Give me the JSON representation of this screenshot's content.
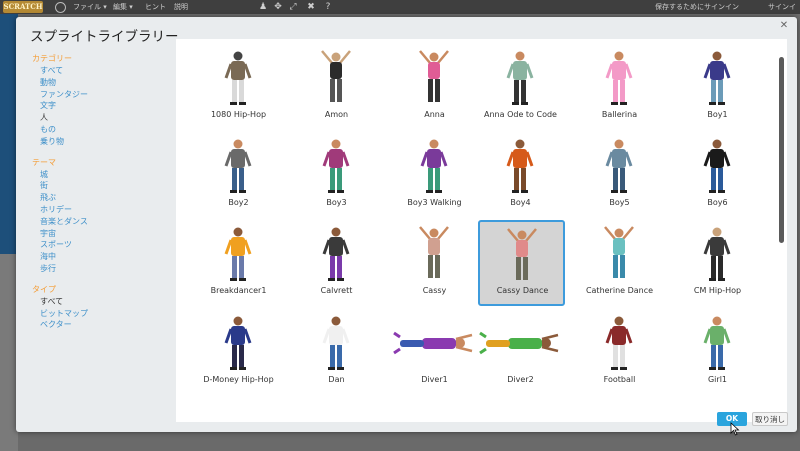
{
  "app": {
    "logo": "SCRATCH",
    "menus": [
      "ファイル ▾",
      "編集 ▾",
      "ヒント",
      "説明"
    ],
    "toolbar_icons": [
      "person-icon",
      "move-icon",
      "grow-icon",
      "shrink-icon",
      "help-icon"
    ],
    "save_notice": "保存するためにサインイン",
    "signin": "サインイ"
  },
  "modal": {
    "title": "スプライトライブラリー",
    "close_label": "✕",
    "ok_label": "OK",
    "cancel_label": "取り消し"
  },
  "sidebar": {
    "category_head": "カテゴリー",
    "categories": [
      {
        "label": "すべて",
        "selected": false
      },
      {
        "label": "動物",
        "selected": false
      },
      {
        "label": "ファンタジー",
        "selected": false
      },
      {
        "label": "文字",
        "selected": false
      },
      {
        "label": "人",
        "selected": true
      },
      {
        "label": "もの",
        "selected": false
      },
      {
        "label": "乗り物",
        "selected": false
      }
    ],
    "theme_head": "テーマ",
    "themes": [
      {
        "label": "城"
      },
      {
        "label": "街"
      },
      {
        "label": "飛ぶ"
      },
      {
        "label": "ホリデー"
      },
      {
        "label": "音楽とダンス"
      },
      {
        "label": "宇宙"
      },
      {
        "label": "スポーツ"
      },
      {
        "label": "海中"
      },
      {
        "label": "歩行"
      }
    ],
    "type_head": "タイプ",
    "types": [
      {
        "label": "すべて",
        "selected": true
      },
      {
        "label": "ビットマップ",
        "selected": false
      },
      {
        "label": "ベクター",
        "selected": false
      }
    ]
  },
  "sprites": [
    {
      "name": "1080 Hip-Hop",
      "colors": [
        "#7a6a55",
        "#d9d9d9",
        "#444444"
      ]
    },
    {
      "name": "Amon",
      "colors": [
        "#2b2b2b",
        "#555555",
        "#c9a27a"
      ]
    },
    {
      "name": "Anna",
      "colors": [
        "#e05c95",
        "#333333",
        "#c98a60"
      ]
    },
    {
      "name": "Anna Ode to Code",
      "colors": [
        "#8ab3a0",
        "#333333",
        "#c98a60"
      ]
    },
    {
      "name": "Ballerina",
      "colors": [
        "#f39ac7",
        "#f39ac7",
        "#c98a60"
      ]
    },
    {
      "name": "Boy1",
      "colors": [
        "#3a3a8a",
        "#6b9bb8",
        "#8b5a3a"
      ]
    },
    {
      "name": "Boy2",
      "colors": [
        "#6a6a6a",
        "#3a5f8a",
        "#c98a60"
      ]
    },
    {
      "name": "Boy3",
      "colors": [
        "#a03a7a",
        "#3a9a7a",
        "#c98a60"
      ]
    },
    {
      "name": "Boy3 Walking",
      "colors": [
        "#7a3a9a",
        "#3a9a7a",
        "#c98a60"
      ]
    },
    {
      "name": "Boy4",
      "colors": [
        "#d65a1a",
        "#7a4a2a",
        "#8b5a3a"
      ]
    },
    {
      "name": "Boy5",
      "colors": [
        "#6a8aa0",
        "#3a5a7a",
        "#c98a60"
      ]
    },
    {
      "name": "Boy6",
      "colors": [
        "#1a1a1a",
        "#2a5a9a",
        "#8b5a3a"
      ]
    },
    {
      "name": "Breakdancer1",
      "colors": [
        "#f0a020",
        "#6a7aaa",
        "#8b5a3a"
      ]
    },
    {
      "name": "Calvrett",
      "colors": [
        "#3a3a3a",
        "#7a3aaa",
        "#8b5a3a"
      ]
    },
    {
      "name": "Cassy",
      "colors": [
        "#d0a090",
        "#6a6a5a",
        "#c98a60"
      ]
    },
    {
      "name": "Cassy Dance",
      "colors": [
        "#e08a8a",
        "#6a6a5a",
        "#c98a60"
      ]
    },
    {
      "name": "Catherine Dance",
      "colors": [
        "#6ac0c0",
        "#3a8aaa",
        "#c98a60"
      ]
    },
    {
      "name": "CM Hip-Hop",
      "colors": [
        "#3a3a3a",
        "#2a2a2a",
        "#c9a27a"
      ]
    },
    {
      "name": "D-Money Hip-Hop",
      "colors": [
        "#2a3a8a",
        "#2a2a4a",
        "#8b5a3a"
      ]
    },
    {
      "name": "Dan",
      "colors": [
        "#f0f0f0",
        "#3a6aaa",
        "#8b5a3a"
      ]
    },
    {
      "name": "Diver1",
      "colors": [
        "#8a3ab0",
        "#3a5ab0",
        "#c98a60"
      ]
    },
    {
      "name": "Diver2",
      "colors": [
        "#4ab04a",
        "#e0a020",
        "#8b5a3a"
      ]
    },
    {
      "name": "Football",
      "colors": [
        "#8a2a2a",
        "#e0e0e0",
        "#8b5a3a"
      ]
    },
    {
      "name": "Girl1",
      "colors": [
        "#6ab06a",
        "#3a6aaa",
        "#c98a60"
      ]
    }
  ],
  "colors": {
    "accent": "#3d9bdc",
    "category_head": "#f49d37",
    "link": "#3d8fc9",
    "ok_button": "#2aa4dd"
  }
}
